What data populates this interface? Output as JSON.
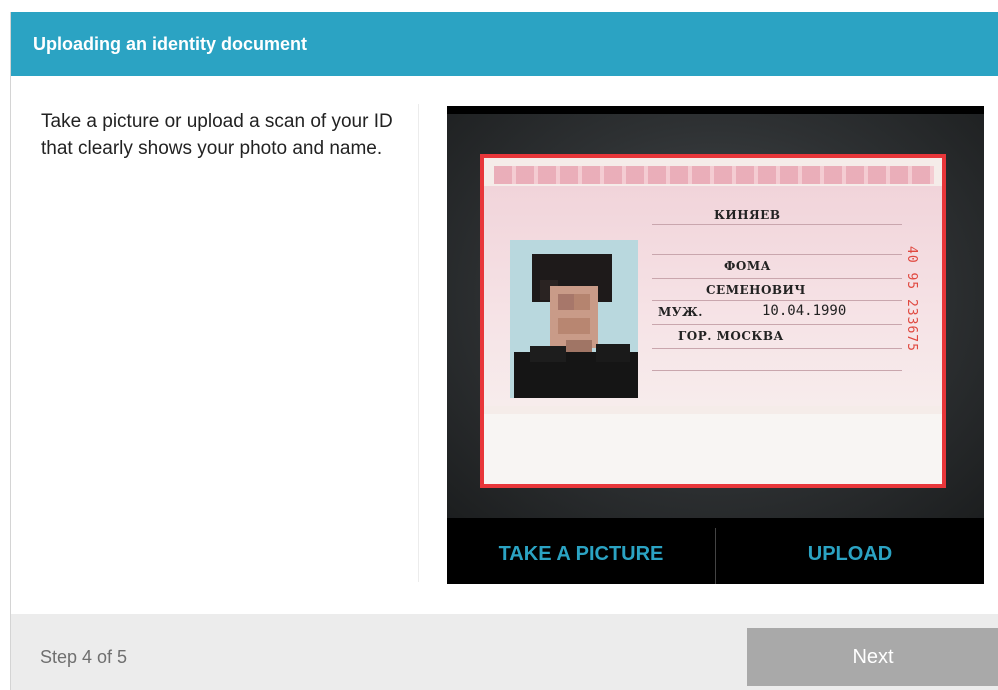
{
  "header": {
    "title": "Uploading an identity document"
  },
  "instruction": "Take a picture or upload a scan of your ID that clearly shows your photo and name.",
  "document": {
    "surname": "КИНЯЕВ",
    "given_name": "ФОМА",
    "patronymic": "СЕМЕНОВИЧ",
    "sex": "МУЖ.",
    "birth_date": "10.04.1990",
    "birth_place": "ГОР. МОСКВА",
    "serial": "40 95 233675"
  },
  "buttons": {
    "take_picture": "TAKE A PICTURE",
    "upload": "UPLOAD"
  },
  "footer": {
    "step_text": "Step 4 of 5",
    "next_label": "Next"
  },
  "colors": {
    "header_bg": "#2ba3c3",
    "accent": "#2ba3c3",
    "frame_red": "#e8363a",
    "next_disabled": "#a9a9a9"
  }
}
